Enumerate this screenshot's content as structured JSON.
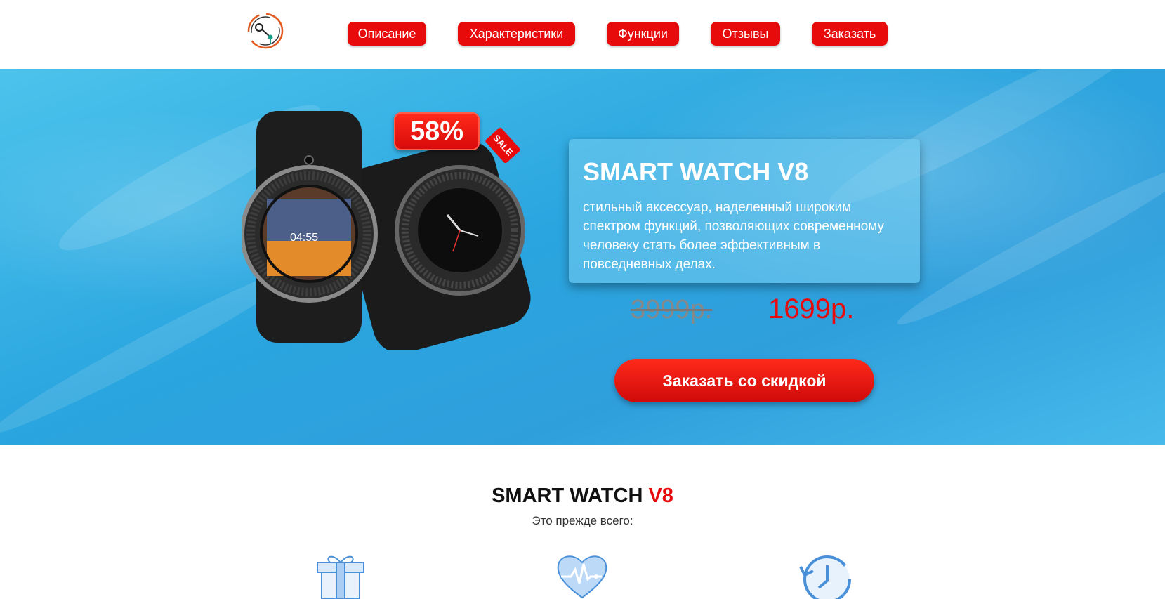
{
  "nav": {
    "items": [
      {
        "label": "Описание"
      },
      {
        "label": "Характеристики"
      },
      {
        "label": "Функции"
      },
      {
        "label": "Отзывы"
      },
      {
        "label": "Заказать"
      }
    ]
  },
  "hero": {
    "discount": "58%",
    "sale_tag": "SALE",
    "title": "SMART WATCH V8",
    "description": "стильный аксессуар, наделенный широким спектром функций, позволяющих современному человеку стать более эффективным в повседневных делах.",
    "old_price": "3999р.",
    "new_price": "1699р.",
    "cta_label": "Заказать со скидкой",
    "watch_screen_time": "04:55"
  },
  "features": {
    "title_main": "SMART WATCH ",
    "title_accent": "V8",
    "subtitle": "Это прежде всего:",
    "icons": [
      "gift-icon",
      "heart-pulse-icon",
      "clock-history-icon"
    ]
  },
  "colors": {
    "accent": "#e80b0b",
    "hero_bg": "#2aa5df",
    "icon_blue": "#4a90d9"
  }
}
